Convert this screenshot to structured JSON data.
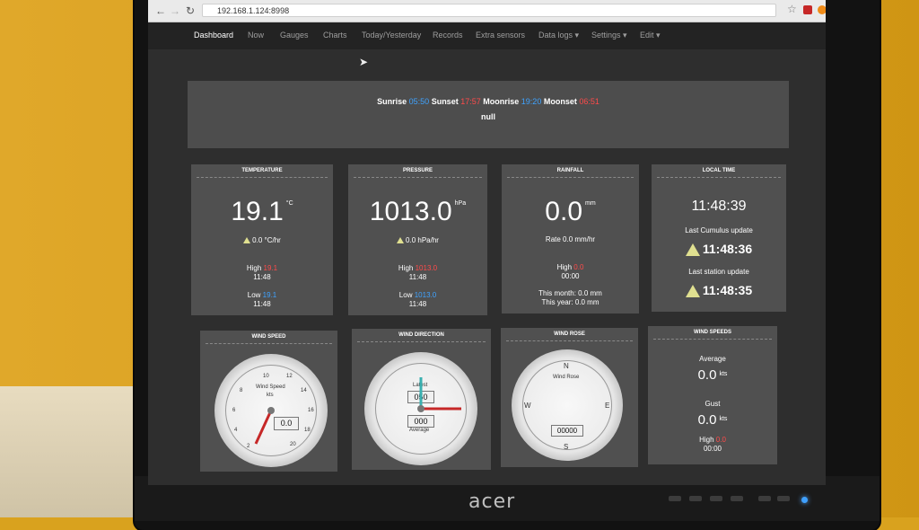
{
  "browser": {
    "url": "192.168.1.124:8998"
  },
  "nav": {
    "items": [
      "Dashboard",
      "Now",
      "Gauges",
      "Charts",
      "Today/Yesterday",
      "Records",
      "Extra sensors",
      "Data logs ▾",
      "Settings ▾",
      "Edit ▾"
    ],
    "active": "Dashboard"
  },
  "banner": {
    "sunrise_label": "Sunrise",
    "sunrise": "05:50",
    "sunset_label": "Sunset",
    "sunset": "17:57",
    "moonrise_label": "Moonrise",
    "moonrise": "19:20",
    "moonset_label": "Moonset",
    "moonset": "06:51",
    "subline": "null"
  },
  "temperature": {
    "title": "TEMPERATURE",
    "value": "19.1",
    "unit": "°C",
    "trend": "0.0 °C/hr",
    "high_label": "High",
    "high": "19.1",
    "high_time": "11:48",
    "low_label": "Low",
    "low": "19.1",
    "low_time": "11:48"
  },
  "pressure": {
    "title": "PRESSURE",
    "value": "1013.0",
    "unit": "hPa",
    "trend": "0.0 hPa/hr",
    "high_label": "High",
    "high": "1013.0",
    "high_time": "11:48",
    "low_label": "Low",
    "low": "1013.0",
    "low_time": "11:48"
  },
  "rainfall": {
    "title": "RAINFALL",
    "value": "0.0",
    "unit": "mm",
    "rate": "Rate 0.0 mm/hr",
    "high_label": "High",
    "high": "0.0",
    "high_time": "00:00",
    "month": "This month: 0.0 mm",
    "year": "This year: 0.0 mm"
  },
  "local_time": {
    "title": "LOCAL TIME",
    "time": "11:48:39",
    "cumulus_label": "Last Cumulus update",
    "cumulus_time": "11:48:36",
    "station_label": "Last station update",
    "station_time": "11:48:35"
  },
  "wind_speed": {
    "title": "WIND SPEED",
    "gauge_label": "Wind Speed",
    "gauge_unit": "kts",
    "reading": "0.0",
    "scale": [
      "2",
      "4",
      "6",
      "8",
      "10",
      "12",
      "14",
      "16",
      "18",
      "20"
    ]
  },
  "wind_direction": {
    "title": "WIND DIRECTION",
    "latest_label": "Latest",
    "latest": "050",
    "average_label": "Average",
    "average": "000"
  },
  "wind_rose": {
    "title": "WIND ROSE",
    "gauge_label": "Wind Rose",
    "counter": "00000",
    "n": "N",
    "s": "S",
    "w": "W",
    "e": "E"
  },
  "wind_speeds": {
    "title": "WIND SPEEDS",
    "average_label": "Average",
    "average": "0.0",
    "gust_label": "Gust",
    "gust": "0.0",
    "unit": "kts",
    "high_label": "High",
    "high": "0.0",
    "high_time": "00:00"
  },
  "colors": {
    "blue": "#3fa3ff",
    "red": "#ff4a4a",
    "panel": "#505050"
  },
  "monitor": {
    "brand": "acer"
  }
}
